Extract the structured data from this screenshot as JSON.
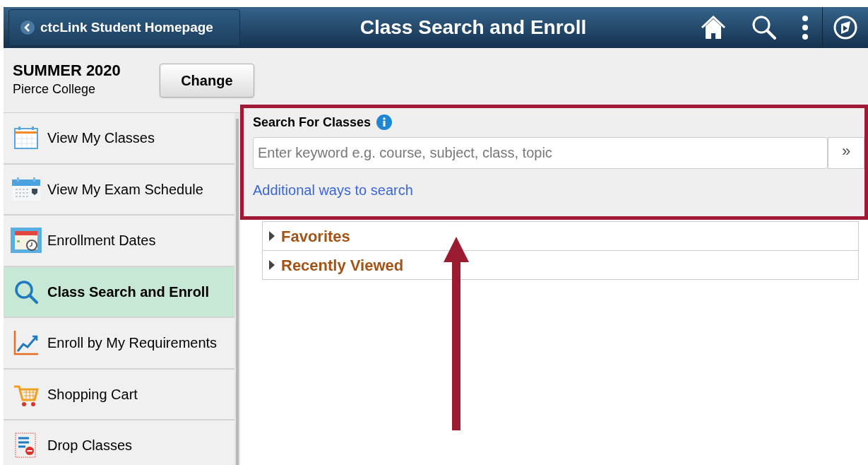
{
  "header": {
    "back_button": "ctcLink Student Homepage",
    "title": "Class Search and Enroll"
  },
  "term": {
    "name": "SUMMER 2020",
    "institution": "Pierce College",
    "change_button": "Change"
  },
  "sidebar": {
    "items": [
      {
        "label": "View My Classes",
        "selected": false
      },
      {
        "label": "View My Exam Schedule",
        "selected": false
      },
      {
        "label": "Enrollment Dates",
        "selected": false
      },
      {
        "label": "Class Search and Enroll",
        "selected": true
      },
      {
        "label": "Enroll by My Requirements",
        "selected": false
      },
      {
        "label": "Shopping Cart",
        "selected": false
      },
      {
        "label": "Drop Classes",
        "selected": false
      }
    ]
  },
  "search": {
    "label": "Search For Classes",
    "placeholder": "Enter keyword e.g. course, subject, class, topic",
    "submit": "»",
    "link": "Additional ways to search"
  },
  "sections": [
    {
      "label": "Favorites",
      "expanded": false
    },
    {
      "label": "Recently Viewed",
      "expanded": false
    }
  ]
}
